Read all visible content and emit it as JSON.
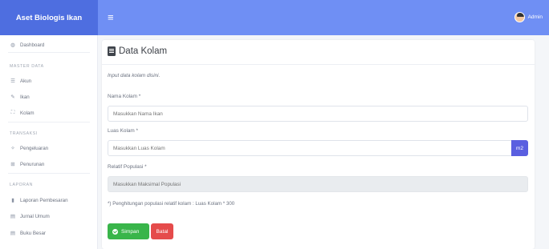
{
  "app": {
    "brand": "Aset Biologis Ikan"
  },
  "topbar": {
    "menu_icon": "≡",
    "user_name": "Admin"
  },
  "sidebar": {
    "dashboard": {
      "label": "Dashboard",
      "icon": "dashboard-icon"
    },
    "sections": [
      {
        "title": "MASTER DATA",
        "items": [
          {
            "label": "Akun",
            "icon": "list-icon"
          },
          {
            "label": "Ikan",
            "icon": "fish-icon"
          },
          {
            "label": "Kolam",
            "icon": "pond-icon"
          }
        ]
      },
      {
        "title": "TRANSAKSI",
        "items": [
          {
            "label": "Pengeluaran",
            "icon": "feed-icon"
          },
          {
            "label": "Penurunan",
            "icon": "cart-icon"
          }
        ]
      },
      {
        "title": "LAPORAN",
        "items": [
          {
            "label": "Laporan Pembesaran",
            "icon": "chart-icon"
          },
          {
            "label": "Jurnal Umum",
            "icon": "journal-icon"
          },
          {
            "label": "Buku Besar",
            "icon": "book-icon"
          }
        ]
      }
    ]
  },
  "form": {
    "title": "Data Kolam",
    "hint": "Input data kolam disini.",
    "nama_label": "Nama Kolam *",
    "nama_placeholder": "Masukkan Nama Ikan",
    "luas_label": "Luas Kolam *",
    "luas_placeholder": "Masukkan Luas Kolam",
    "luas_unit": "m2",
    "populasi_label": "Relatif Populasi *",
    "populasi_placeholder": "Masukkan Maksimal Populasi",
    "note": "*) Penghitungan populasi relatif kolam : Luas Kolam * 300",
    "save_label": "Simpan",
    "cancel_label": "Batal"
  },
  "colors": {
    "brand": "#4e6ee0",
    "topbar": "#6f8ff4",
    "save": "#39b54a",
    "cancel": "#e54b4b",
    "addon": "#5a5fe0"
  }
}
